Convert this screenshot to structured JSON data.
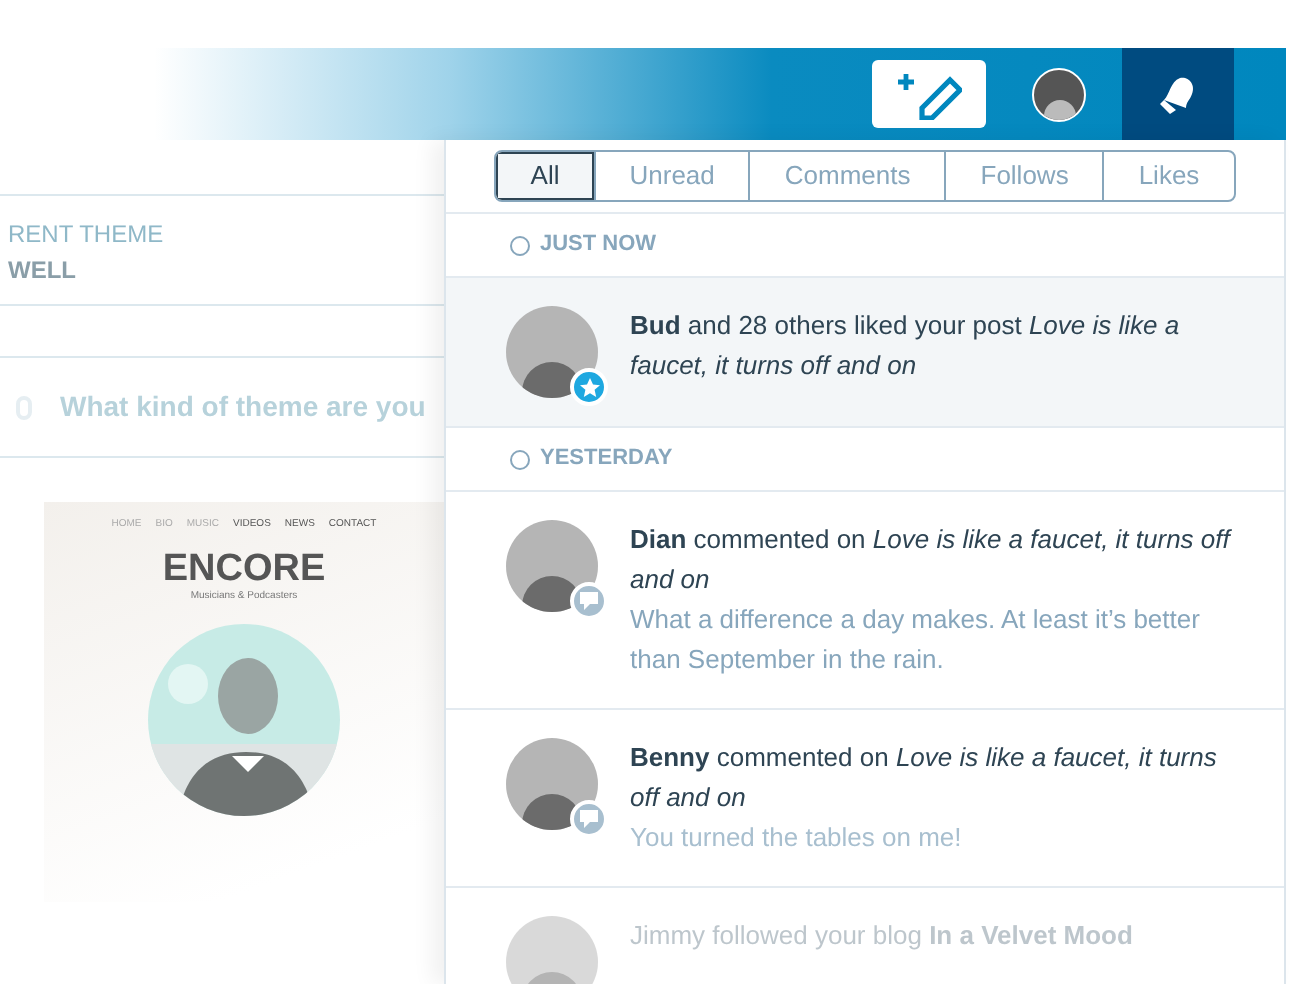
{
  "background": {
    "theme_label": "RENT THEME",
    "theme_name": "WELL",
    "search": {
      "placeholder": "What kind of theme are you"
    },
    "preview": {
      "nav": [
        "HOME",
        "BIO",
        "MUSIC",
        "VIDEOS",
        "NEWS",
        "CONTACT"
      ],
      "title": "ENCORE",
      "tagline": "Musicians & Podcasters",
      "kind": "picture"
    }
  },
  "tabs": [
    {
      "label": "All",
      "selected": true
    },
    {
      "label": "Unread",
      "selected": false
    },
    {
      "label": "Comments",
      "selected": false
    },
    {
      "label": "Follows",
      "selected": false
    },
    {
      "label": "Likes",
      "selected": false
    }
  ],
  "groups": [
    {
      "heading": "JUST NOW",
      "items": [
        {
          "text": "**Bud** and 28 others liked your post *Love is like a faucet, it turns off and on*",
          "kind": "like",
          "unread": true,
          "faded": false
        }
      ]
    },
    {
      "heading": "YESTERDAY",
      "items": [
        {
          "text": "**Dian** commented on *Love is like a faucet, it turns off and on*",
          "comment": "What a difference a day makes. At least it’s better than September in the rain.",
          "kind": "comment",
          "unread": false,
          "faded": false
        },
        {
          "text": "**Benny** commented on *Love is like a faucet, it turns off and on*",
          "comment": "You turned the tables on me!",
          "kind": "comment",
          "unread": false,
          "faded": false
        },
        {
          "text": "Jimmy followed your blog **In a Velvet Mood**",
          "kind": "follow",
          "unread": false,
          "faded": true
        }
      ]
    }
  ]
}
